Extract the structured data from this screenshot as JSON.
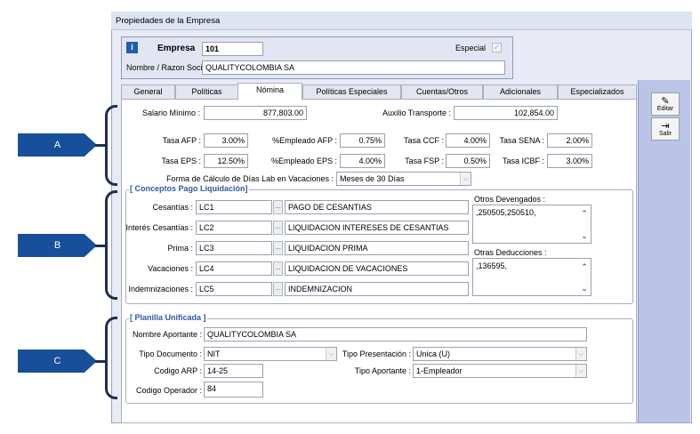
{
  "window": {
    "title": "Propiedades de la Empresa"
  },
  "header": {
    "empresa_label": "Empresa",
    "empresa_value": "101",
    "especial_label": "Especial",
    "razon_label": "Nombre / Razon Social",
    "razon_value": "QUALITYCOLOMBIA SA",
    "info_icon": "i"
  },
  "tabs": [
    "General",
    "Políticas",
    "Nómina",
    "Políticas Especiales",
    "Cuentas/Otros",
    "Adicionales",
    "Especializados"
  ],
  "active_tab": "Nómina",
  "side_buttons": {
    "edit": "Editar",
    "exit": "Salir"
  },
  "nomina": {
    "salario_label": "Salario Mínimo :",
    "salario_value": "877,803.00",
    "auxilio_label": "Auxilio Transporte :",
    "auxilio_value": "102,854.00",
    "tasa_afp_label": "Tasa AFP :",
    "tasa_afp": "3.00%",
    "emp_afp_label": "%Empleado AFP :",
    "emp_afp": "0.75%",
    "tasa_ccf_label": "Tasa CCF :",
    "tasa_ccf": "4.00%",
    "tasa_sena_label": "Tasa SENA :",
    "tasa_sena": "2.00%",
    "tasa_eps_label": "Tasa EPS :",
    "tasa_eps": "12.50%",
    "emp_eps_label": "%Empleado EPS :",
    "emp_eps": "4.00%",
    "tasa_fsp_label": "Tasa FSP :",
    "tasa_fsp": "0.50%",
    "tasa_icbf_label": "Tasa ICBF :",
    "tasa_icbf": "3.00%",
    "forma_label": "Forma de Cálculo de Días Lab en Vacaciones :",
    "forma_value": "Meses de 30 Días"
  },
  "conceptos": {
    "title": "[ Conceptos Pago Liquidación]",
    "rows": [
      {
        "label": "Cesantías :",
        "code": "LC1",
        "desc": "PAGO DE CESANTIAS"
      },
      {
        "label": "Interés Cesantías :",
        "code": "LC2",
        "desc": "LIQUIDACION INTERESES DE CESANTIAS"
      },
      {
        "label": "Prima :",
        "code": "LC3",
        "desc": "LIQUIDACION PRIMA"
      },
      {
        "label": "Vacaciones :",
        "code": "LC4",
        "desc": "LIQUIDACION DE VACACIONES"
      },
      {
        "label": "Indemnizaciones :",
        "code": "LC5",
        "desc": "INDEMNIZACION"
      }
    ],
    "otros_dev_label": "Otros Devengados :",
    "otros_dev_value": ",250505,250510,",
    "otras_ded_label": "Otras Deducciones :",
    "otras_ded_value": ",136595,"
  },
  "planilla": {
    "title": "[ Planilla Unificada ]",
    "aportante_label": "Nombre Aportante :",
    "aportante_value": "QUALITYCOLOMBIA SA",
    "tipo_doc_label": "Tipo Documento :",
    "tipo_doc_value": "NIT",
    "tipo_pres_label": "Tipo Presentación :",
    "tipo_pres_value": "Unica (U)",
    "arp_label": "Codigo ARP :",
    "arp_value": "14-25",
    "tipo_aport_label": "Tipo Aportante :",
    "tipo_aport_value": "1-Empleador",
    "operador_label": "Codigo Operador :",
    "operador_value": "84"
  },
  "callouts": [
    "A",
    "B",
    "C"
  ],
  "colors": {
    "callout": "#174f9a",
    "group_title": "#2e58a7",
    "side_panel": "#b9c4e6"
  }
}
